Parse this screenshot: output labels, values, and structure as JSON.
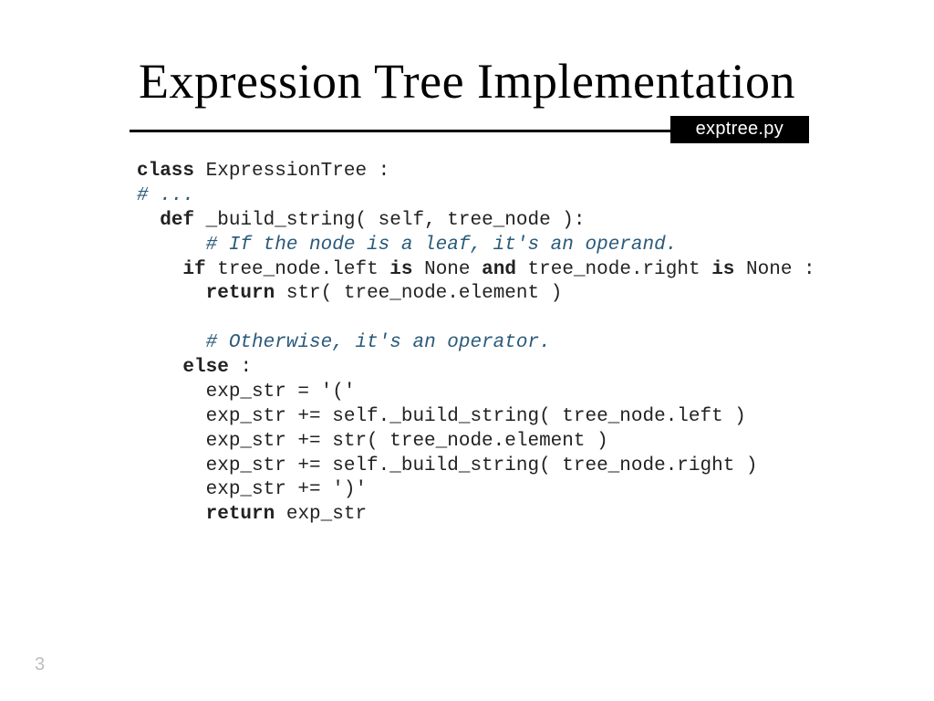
{
  "title": "Expression Tree Implementation",
  "file_tab": "exptree.py",
  "page_number": "3",
  "code": {
    "l01_kw": "class",
    "l01_rest": " ExpressionTree :",
    "l02_cm": "# ...",
    "l03_pad": "  ",
    "l03_kw": "def",
    "l03_rest": " _build_string( self, tree_node ):",
    "l04_pad": "      ",
    "l04_cm": "# If the node is a leaf, it's an operand.",
    "l05_pad": "    ",
    "l05_kw1": "if",
    "l05_mid1": " tree_node.left ",
    "l05_kw2": "is",
    "l05_mid2": " None ",
    "l05_kw3": "and",
    "l05_mid3": " tree_node.right ",
    "l05_kw4": "is",
    "l05_rest": " None :",
    "l06_pad": "      ",
    "l06_kw": "return",
    "l06_rest": " str( tree_node.element )",
    "l07_blank": "",
    "l08_pad": "      ",
    "l08_cm": "# Otherwise, it's an operator.",
    "l09_pad": "    ",
    "l09_kw": "else",
    "l09_rest": " :",
    "l10": "      exp_str = '('",
    "l11": "      exp_str += self._build_string( tree_node.left )",
    "l12": "      exp_str += str( tree_node.element )",
    "l13": "      exp_str += self._build_string( tree_node.right )",
    "l14": "      exp_str += ')'",
    "l15_pad": "      ",
    "l15_kw": "return",
    "l15_rest": " exp_str"
  }
}
